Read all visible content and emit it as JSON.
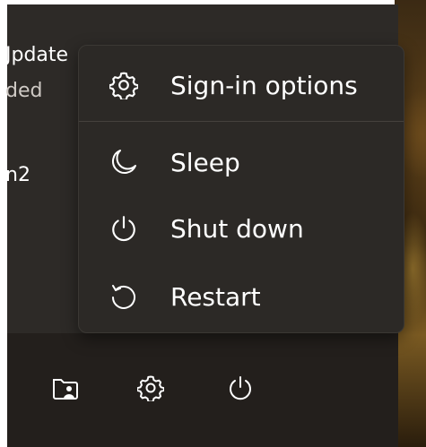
{
  "background_panel": {
    "update_title_fragment": "Jpdate",
    "update_status_fragment": "ded",
    "user_fragment": "n2"
  },
  "power_menu": {
    "items": [
      {
        "label": "Sign-in options",
        "icon": "gear-icon"
      },
      {
        "label": "Sleep",
        "icon": "moon-icon"
      },
      {
        "label": "Shut down",
        "icon": "power-icon"
      },
      {
        "label": "Restart",
        "icon": "restart-icon"
      }
    ]
  },
  "bottom_bar": {
    "icons": [
      "file-explorer-icon",
      "settings-icon",
      "power-icon"
    ]
  },
  "colors": {
    "menu_background": "#2c2926",
    "panel_background": "#2d2a27",
    "bottom_bar_background": "#231f1c",
    "text": "#ffffff"
  }
}
